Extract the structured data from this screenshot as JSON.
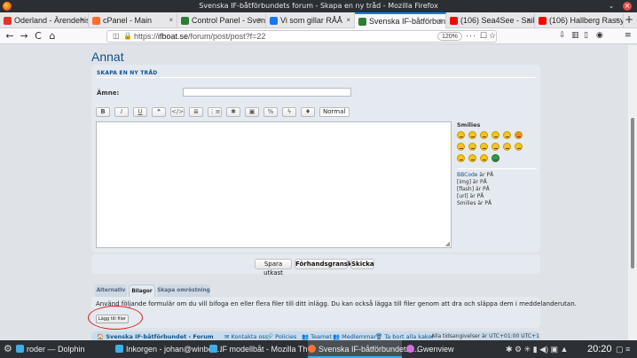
{
  "window": {
    "title": "Svenska IF-båtförbundets forum - Skapa en ny tråd - Mozilla Firefox",
    "controls": {
      "min": "⌄",
      "max": "⌃",
      "close": "×"
    }
  },
  "tabs": [
    {
      "label": "Oderland - Ärendehistoi",
      "color": "#e0332b"
    },
    {
      "label": "cPanel - Main",
      "color": "#ff6c2c"
    },
    {
      "label": "Control Panel - Svensk",
      "color": "#2e7d32"
    },
    {
      "label": "Vi som gillar RÅÅ",
      "color": "#1877f2"
    },
    {
      "label": "Svenska IF-båtförbunde",
      "color": "#2e7d32",
      "active": true
    },
    {
      "label": "(106) Sea4See - Sailing",
      "color": "#ff0000"
    },
    {
      "label": "(106) Hallberg Rassy",
      "color": "#ff0000"
    }
  ],
  "tab_close": "×",
  "tab_new": "+",
  "nav": {
    "back": "←",
    "forward": "→",
    "reload": "C",
    "home": "⌂",
    "url_prefix": "https://",
    "url_domain": "ifboat.se",
    "url_path": "/forum/post/post?f=22",
    "zoom": "120%",
    "more": "···",
    "shield": "◫",
    "lock": "🔒",
    "pocket": "☐",
    "bookmark": "☆",
    "download": "⇩",
    "library": "▥",
    "sidebar": "▯",
    "mask": "◉",
    "menu": "≡"
  },
  "page": {
    "heading": "Annat",
    "panel_title": "SKAPA EN NY TRÅD",
    "subject_label": "Ämne:",
    "subject_value": "",
    "toolbar": [
      "B",
      "I",
      "U",
      "❝",
      "</>",
      "≣",
      "⋮≡",
      "✱",
      "▣",
      "%",
      "ϟ",
      "♦"
    ],
    "font_size_select": "Normal",
    "smilies_title": "Smilies",
    "smilies": [
      "#f5c518",
      "#f5c518",
      "#f5c518",
      "#f5c518",
      "#f5c518",
      "#f08c24",
      "#f5c518",
      "#f5c518",
      "#f5c518",
      "#f5c518",
      "#f5c518",
      "#f5c518",
      "#f5c518",
      "#f5c518",
      "#f5c518",
      "#2e9c48"
    ],
    "status": {
      "bbcode_link": "BBCode",
      "bbcode_state": " är PÅ",
      "img": "[img] är PÅ",
      "flash": "[flash] är PÅ",
      "url": "[url] är PÅ",
      "smilies": "Smilies är PÅ"
    },
    "buttons": {
      "draft": "Spara utkast",
      "preview": "Förhandsgranska",
      "submit": "Skicka"
    },
    "subtabs": {
      "options": "Alternativ",
      "attachments": "Bilagor",
      "poll": "Skapa omröstning"
    },
    "attach_text": "Använd följande formulär om du vill bifoga en eller flera filer till ditt inlägg. Du kan också lägga till filer genom att dra och släppa dem i meddelanderutan.",
    "add_files": "Lägg till filer",
    "footer": {
      "home": "🏠 Svenska IF-båtförbundet ‹ Forum",
      "contact": "✉ Kontakta oss",
      "policies": "🔗 Policies",
      "team": "👥 Teamet",
      "members": "👥 Medlemmar",
      "delete_cookies": "🗑 Ta bort alla kakor",
      "timezone": "Alla tidsangivelser är UTC+01:00 UTC+1"
    }
  },
  "taskbar": {
    "items": [
      {
        "label": "roder — Dolphin",
        "color": "#3daee9"
      },
      {
        "label": "Inkorgen - johan@winber...",
        "color": "#3daee9"
      },
      {
        "label": "IF modellbåt - Mozilla Thu...",
        "color": "#3daee9"
      },
      {
        "label": "Svenska IF-båtförbundets ...",
        "color": "#ff7139",
        "active": true
      },
      {
        "label": "Gwenview",
        "color": "#d56fe0"
      }
    ],
    "tray_icons": "✱  ⚙  ✳  ▮  ◀)  ▣  ▲",
    "time": "20:20",
    "tray_end": "▢  ≡"
  }
}
